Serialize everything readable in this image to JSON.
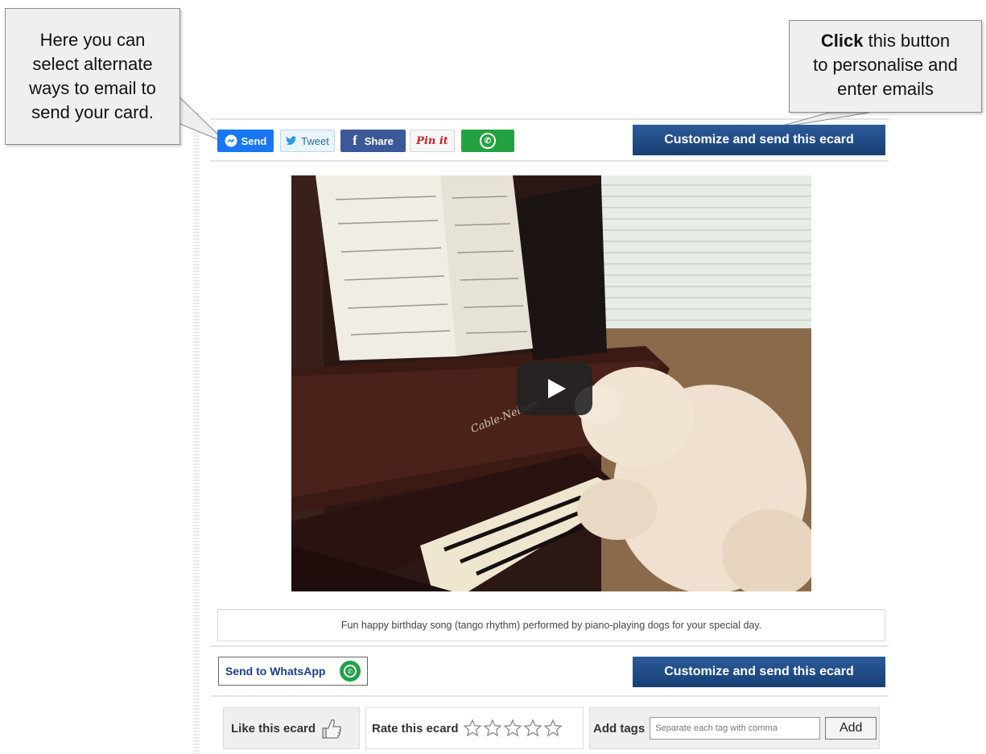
{
  "callouts": {
    "left": {
      "line1": "Here you can",
      "line2": "select alternate",
      "line3": "ways to email to",
      "line4": "send your card."
    },
    "right": {
      "bold": "Click",
      "line1_rest": " this button",
      "line2": "to personalise and",
      "line3": "enter emails"
    }
  },
  "share": {
    "messenger_label": "Send",
    "tweet_label": "Tweet",
    "facebook_label": "Share",
    "pinterest_label": "Pin it",
    "whatsapp_icon": "whatsapp-icon"
  },
  "cta_label": "Customize and send this ecard",
  "video": {
    "caption": "Fun happy birthday song (tango rhythm) performed by piano-playing dogs for your special day.",
    "piano_brand": "Cable-Nelson"
  },
  "whatsapp_send_label": "Send to WhatsApp",
  "like_label": "Like this ecard",
  "rate_label": "Rate this ecard",
  "rating": {
    "value": 0,
    "max": 5
  },
  "tags": {
    "label": "Add tags",
    "placeholder": "Separate each tag with comma",
    "add_label": "Add"
  },
  "colors": {
    "cta": "#1f4a82",
    "messenger": "#1877f2",
    "facebook": "#3b5998",
    "whatsapp": "#22a242",
    "pinterest": "#cb2027"
  }
}
